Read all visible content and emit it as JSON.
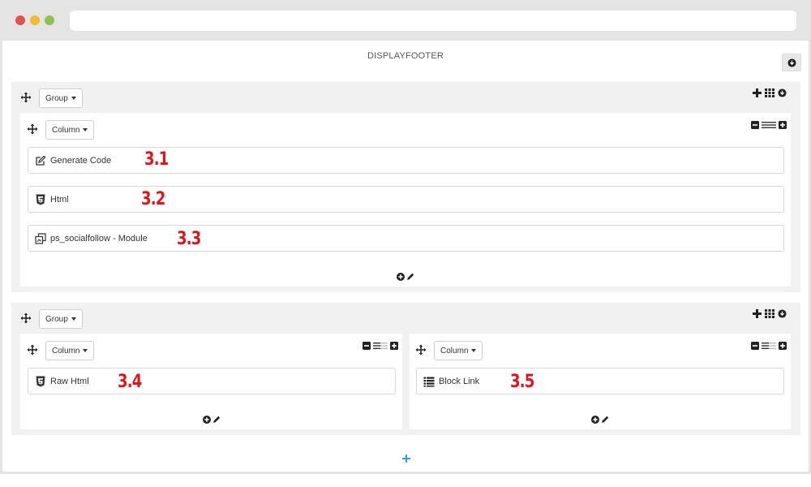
{
  "hook": {
    "title": "DISPLAYFOOTER"
  },
  "groups": [
    {
      "label": "Group",
      "columns": [
        {
          "label": "Column",
          "modules": [
            {
              "label": "Generate Code",
              "icon": "edit-icon",
              "number": "3.1"
            },
            {
              "label": "Html",
              "icon": "html5-icon",
              "number": "3.2"
            },
            {
              "label": "ps_socialfollow - Module",
              "icon": "copy-icon",
              "number": "3.3"
            }
          ]
        }
      ]
    },
    {
      "label": "Group",
      "columns": [
        {
          "label": "Column",
          "modules": [
            {
              "label": "Raw Html",
              "icon": "html5-icon",
              "number": "3.4"
            }
          ]
        },
        {
          "label": "Column",
          "modules": [
            {
              "label": "Block Link",
              "icon": "list-icon",
              "number": "3.5"
            }
          ]
        }
      ]
    }
  ],
  "colors": {
    "accent": "#29a3dc",
    "annotation": "#e0141c",
    "group_bg": "#f1f1f1"
  }
}
